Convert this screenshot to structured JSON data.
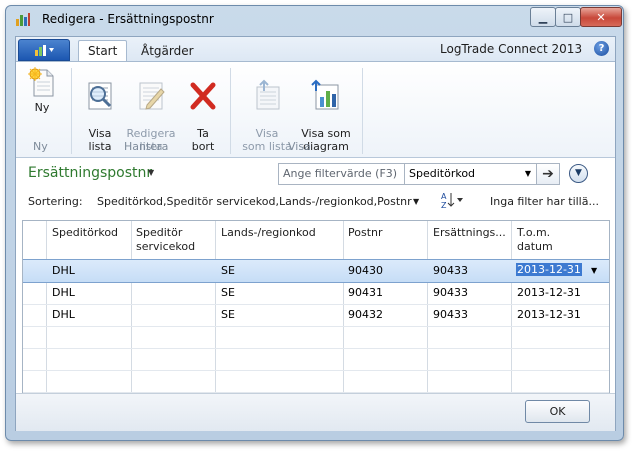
{
  "window": {
    "title": "Redigera - Ersättningspostnr",
    "minimize": "▁",
    "maximize": "□",
    "close": "✕"
  },
  "ribbon": {
    "tabs": [
      {
        "label": "Start"
      },
      {
        "label": "Åtgärder"
      }
    ],
    "brand": "LogTrade Connect 2013",
    "help": "?",
    "groups": {
      "ny": "Ny",
      "hantera": "Hantera",
      "visa": "Visa"
    },
    "buttons": {
      "ny": "Ny",
      "visa_lista": "Visa\nlista",
      "redigera_lista": "Redigera\nlista",
      "ta_bort": "Ta\nbort",
      "visa_som_lista": "Visa\nsom lista",
      "visa_som_diagram": "Visa som\ndiagram"
    }
  },
  "page": {
    "title": "Ersättningspostnr",
    "filter_placeholder": "Ange filtervärde (F3)",
    "filter_field": "Speditörkod",
    "sort_label": "Sortering:",
    "sort_value": "Speditörkod,Speditör servicekod,Lands-/regionkod,Postnr",
    "no_filter": "Inga filter har tillä..."
  },
  "table": {
    "columns": [
      {
        "label": "Speditörkod"
      },
      {
        "label": "Speditör\nservicekod"
      },
      {
        "label": "Lands-/regionkod"
      },
      {
        "label": "Postnr"
      },
      {
        "label": "Ersättnings..."
      },
      {
        "label": "T.o.m.\ndatum"
      }
    ],
    "rows": [
      {
        "speditor": "DHL",
        "service": "",
        "land": "SE",
        "postnr": "90430",
        "ersattning": "90433",
        "datum": "2013-12-31"
      },
      {
        "speditor": "DHL",
        "service": "",
        "land": "SE",
        "postnr": "90431",
        "ersattning": "90433",
        "datum": "2013-12-31"
      },
      {
        "speditor": "DHL",
        "service": "",
        "land": "SE",
        "postnr": "90432",
        "ersattning": "90433",
        "datum": "2013-12-31"
      }
    ]
  },
  "footer": {
    "ok": "OK"
  },
  "colors": {
    "title_green": "#2f7a2f",
    "selection": "#3d7ad1"
  }
}
